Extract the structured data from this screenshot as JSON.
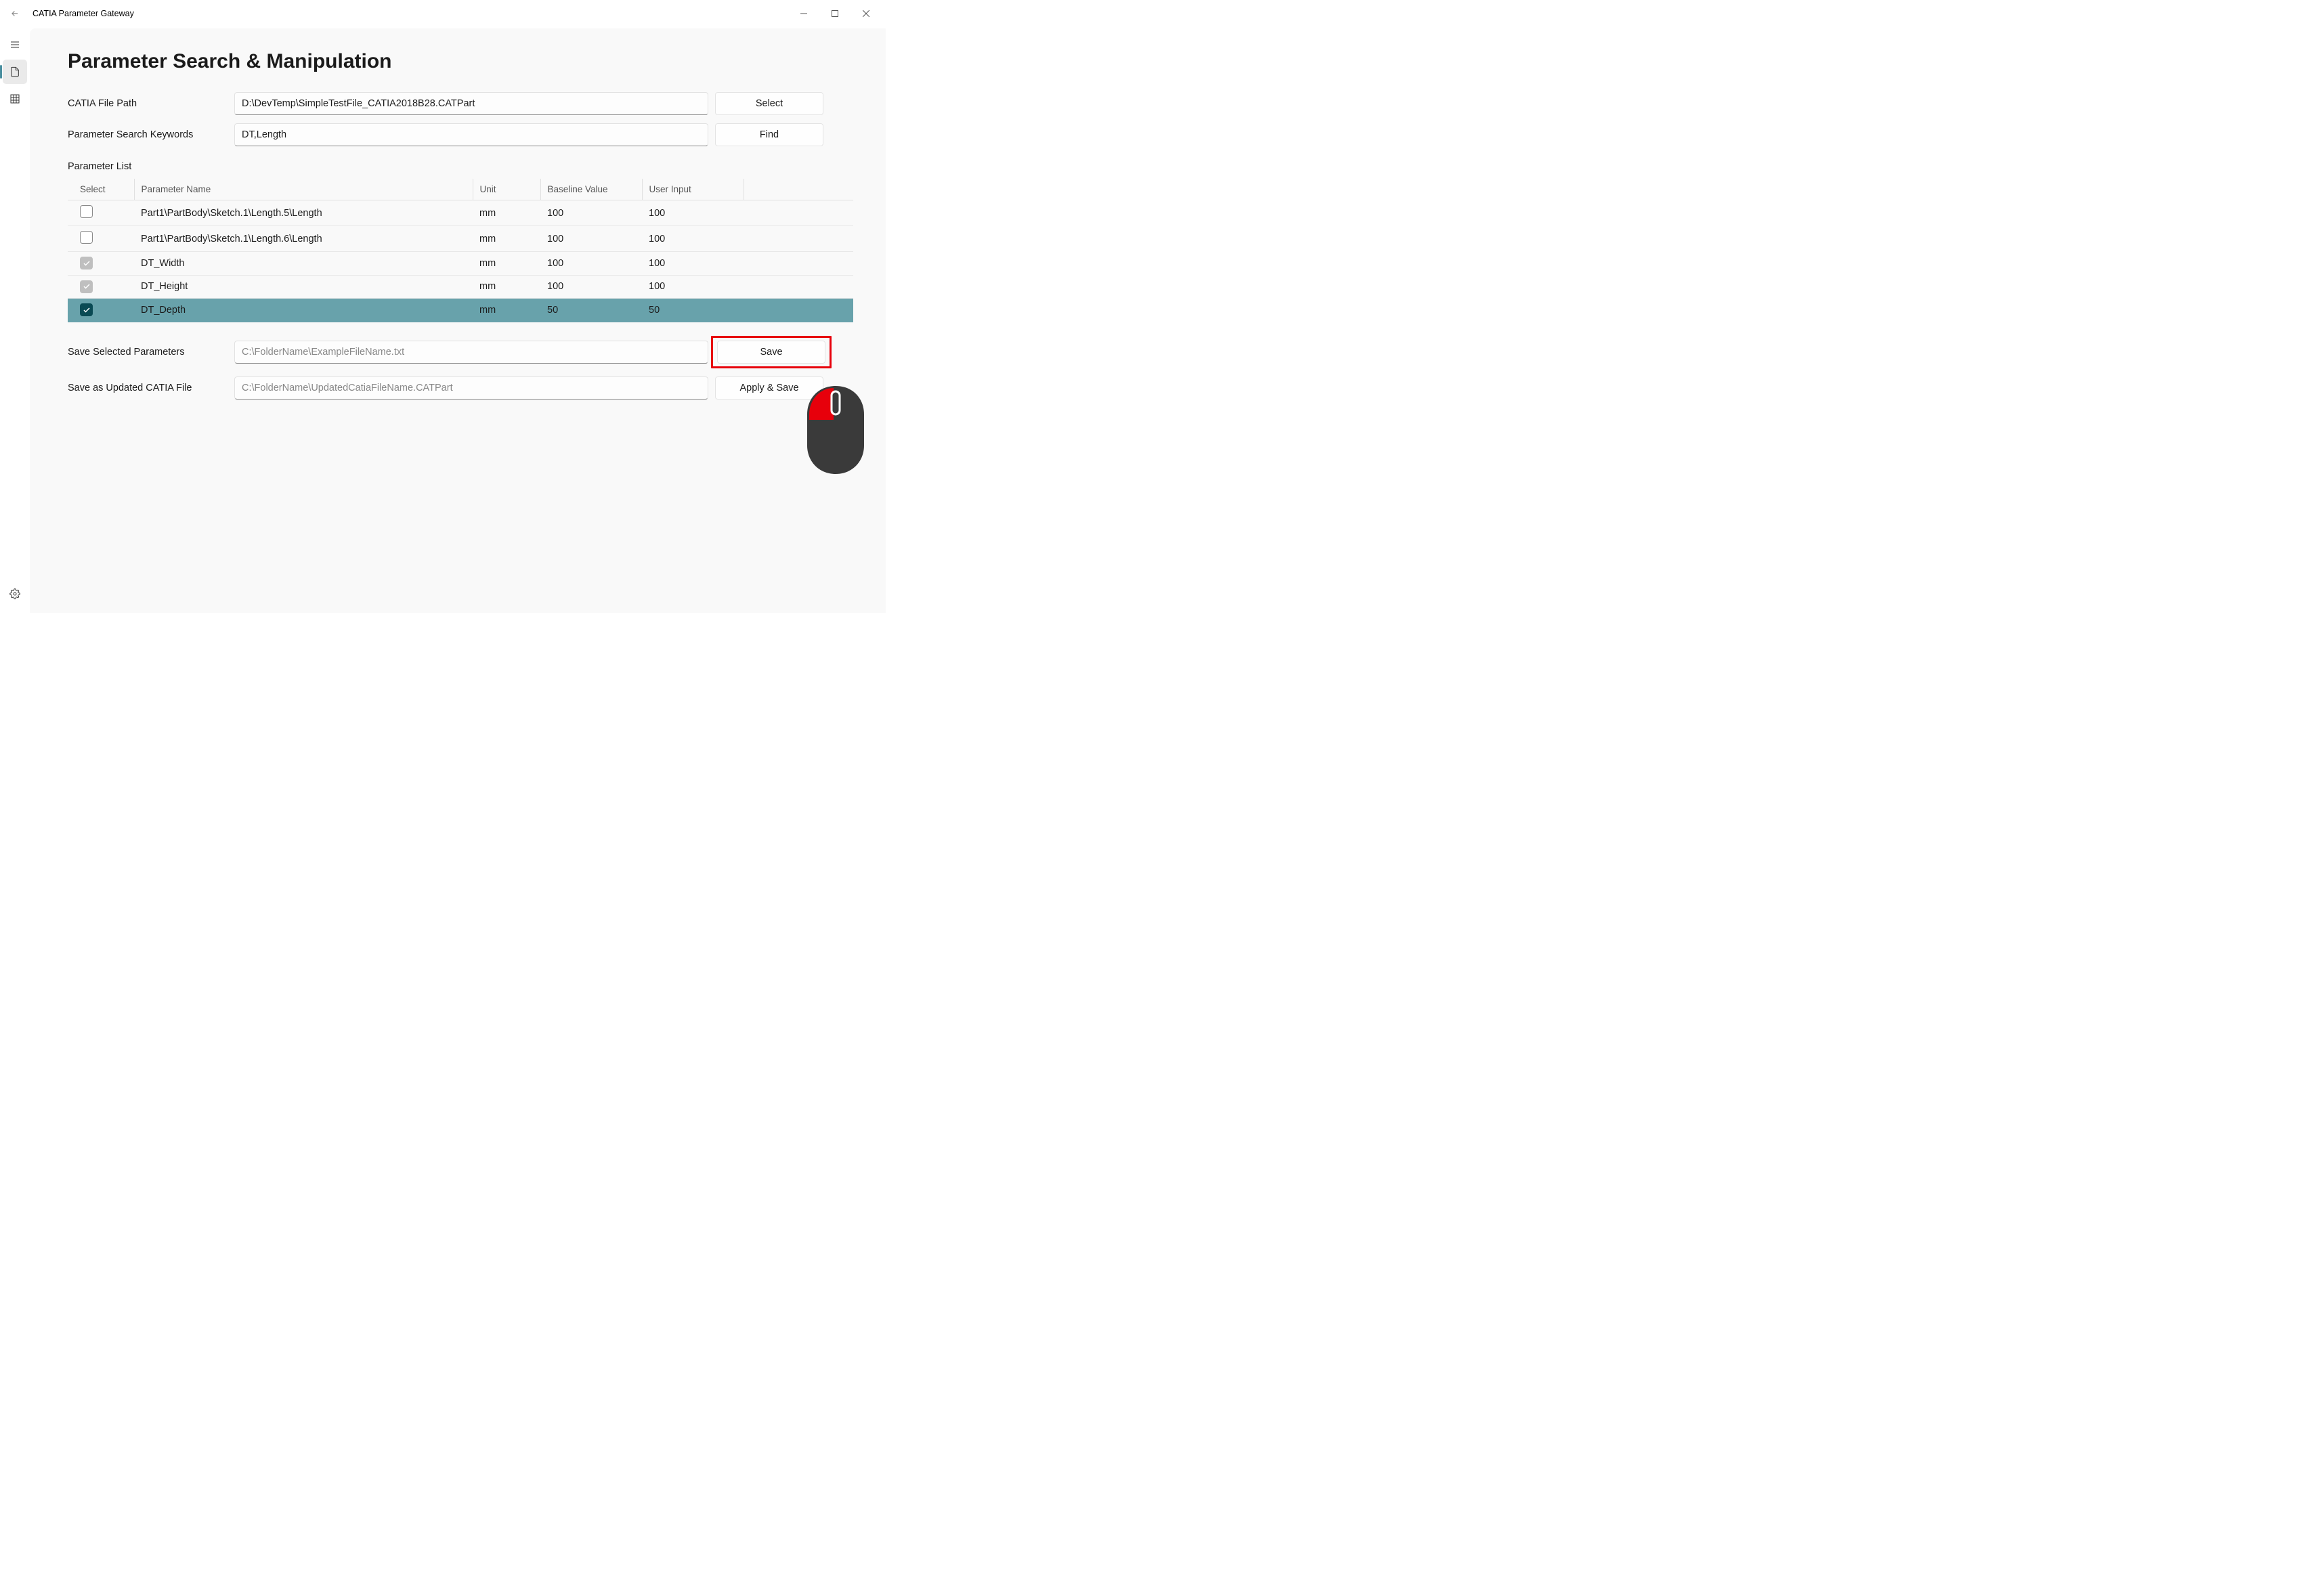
{
  "window": {
    "title": "CATIA Parameter Gateway"
  },
  "page": {
    "title": "Parameter Search & Manipulation"
  },
  "labels": {
    "file_path": "CATIA File Path",
    "search_keywords": "Parameter Search Keywords",
    "parameter_list": "Parameter List",
    "save_selected": "Save Selected Parameters",
    "save_updated": "Save as Updated CATIA File"
  },
  "inputs": {
    "file_path_value": "D:\\DevTemp\\SimpleTestFile_CATIA2018B28.CATPart",
    "search_keywords_value": "DT,Length",
    "save_selected_placeholder": "C:\\FolderName\\ExampleFileName.txt",
    "save_updated_placeholder": "C:\\FolderName\\UpdatedCatiaFileName.CATPart"
  },
  "buttons": {
    "select": "Select",
    "find": "Find",
    "save": "Save",
    "apply_save": "Apply & Save"
  },
  "table": {
    "headers": {
      "select": "Select",
      "name": "Parameter Name",
      "unit": "Unit",
      "baseline": "Baseline Value",
      "userinput": "User Input"
    },
    "rows": [
      {
        "checked": "none",
        "name": "Part1\\PartBody\\Sketch.1\\Length.5\\Length",
        "unit": "mm",
        "baseline": "100",
        "userinput": "100",
        "highlighted": false
      },
      {
        "checked": "none",
        "name": "Part1\\PartBody\\Sketch.1\\Length.6\\Length",
        "unit": "mm",
        "baseline": "100",
        "userinput": "100",
        "highlighted": false
      },
      {
        "checked": "gray",
        "name": "DT_Width",
        "unit": "mm",
        "baseline": "100",
        "userinput": "100",
        "highlighted": false
      },
      {
        "checked": "gray",
        "name": "DT_Height",
        "unit": "mm",
        "baseline": "100",
        "userinput": "100",
        "highlighted": false
      },
      {
        "checked": "dark",
        "name": "DT_Depth",
        "unit": "mm",
        "baseline": "50",
        "userinput": "50",
        "highlighted": true
      }
    ]
  }
}
